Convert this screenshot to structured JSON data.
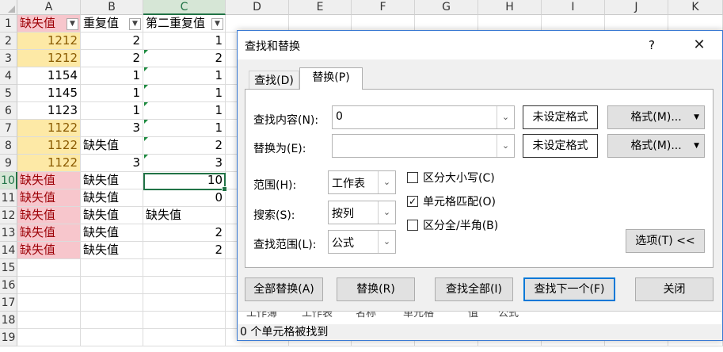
{
  "columns": [
    "A",
    "B",
    "C",
    "D",
    "E",
    "F",
    "G",
    "H",
    "I",
    "J",
    "K"
  ],
  "rows": [
    "1",
    "2",
    "3",
    "4",
    "5",
    "6",
    "7",
    "8",
    "9",
    "10",
    "11",
    "12",
    "13",
    "14",
    "15",
    "16",
    "17",
    "18",
    "19"
  ],
  "headers": {
    "a": "缺失值",
    "b": "重复值",
    "c": "第二重复值"
  },
  "grid": [
    [
      "1212",
      "2",
      "1"
    ],
    [
      "1212",
      "2",
      "2"
    ],
    [
      "1154",
      "1",
      "1"
    ],
    [
      "1145",
      "1",
      "1"
    ],
    [
      "1123",
      "1",
      "1"
    ],
    [
      "1122",
      "3",
      "1"
    ],
    [
      "1122",
      "缺失值",
      "2"
    ],
    [
      "1122",
      "3",
      "3"
    ],
    [
      "缺失值",
      "缺失值",
      "10"
    ],
    [
      "缺失值",
      "缺失值",
      "0"
    ],
    [
      "缺失值",
      "缺失值",
      "缺失值"
    ],
    [
      "缺失值",
      "缺失值",
      "2"
    ],
    [
      "缺失值",
      "缺失值",
      "2"
    ]
  ],
  "colors": {
    "yellow_fill": "#fde9a6",
    "pink_fill": "#f7c6cc",
    "selection": "#217346",
    "accent": "#0078d7"
  },
  "dialog": {
    "title": "查找和替换",
    "help": "?",
    "close": "✕",
    "tabs": {
      "find": "查找(D)",
      "replace": "替换(P)"
    },
    "find_label": "查找内容(N):",
    "find_value": "0",
    "replace_label": "替换为(E):",
    "replace_value": "",
    "no_format": "未设定格式",
    "format_button": "格式(M)...",
    "within_label": "范围(H):",
    "within_value": "工作表",
    "search_label": "搜索(S):",
    "search_value": "按列",
    "lookin_label": "查找范围(L):",
    "lookin_value": "公式",
    "match_case": "区分大小写(C)",
    "match_case_checked": false,
    "match_entire": "单元格匹配(O)",
    "match_entire_checked": true,
    "match_width": "区分全/半角(B)",
    "match_width_checked": false,
    "options_button": "选项(T) <<",
    "replace_all": "全部替换(A)",
    "replace": "替换(R)",
    "find_all": "查找全部(I)",
    "find_next": "查找下一个(F)",
    "close_button": "关闭",
    "result_columns": [
      "工作簿",
      "工作表",
      "名称",
      "单元格",
      "值",
      "公式"
    ],
    "status": "0 个单元格被找到"
  }
}
